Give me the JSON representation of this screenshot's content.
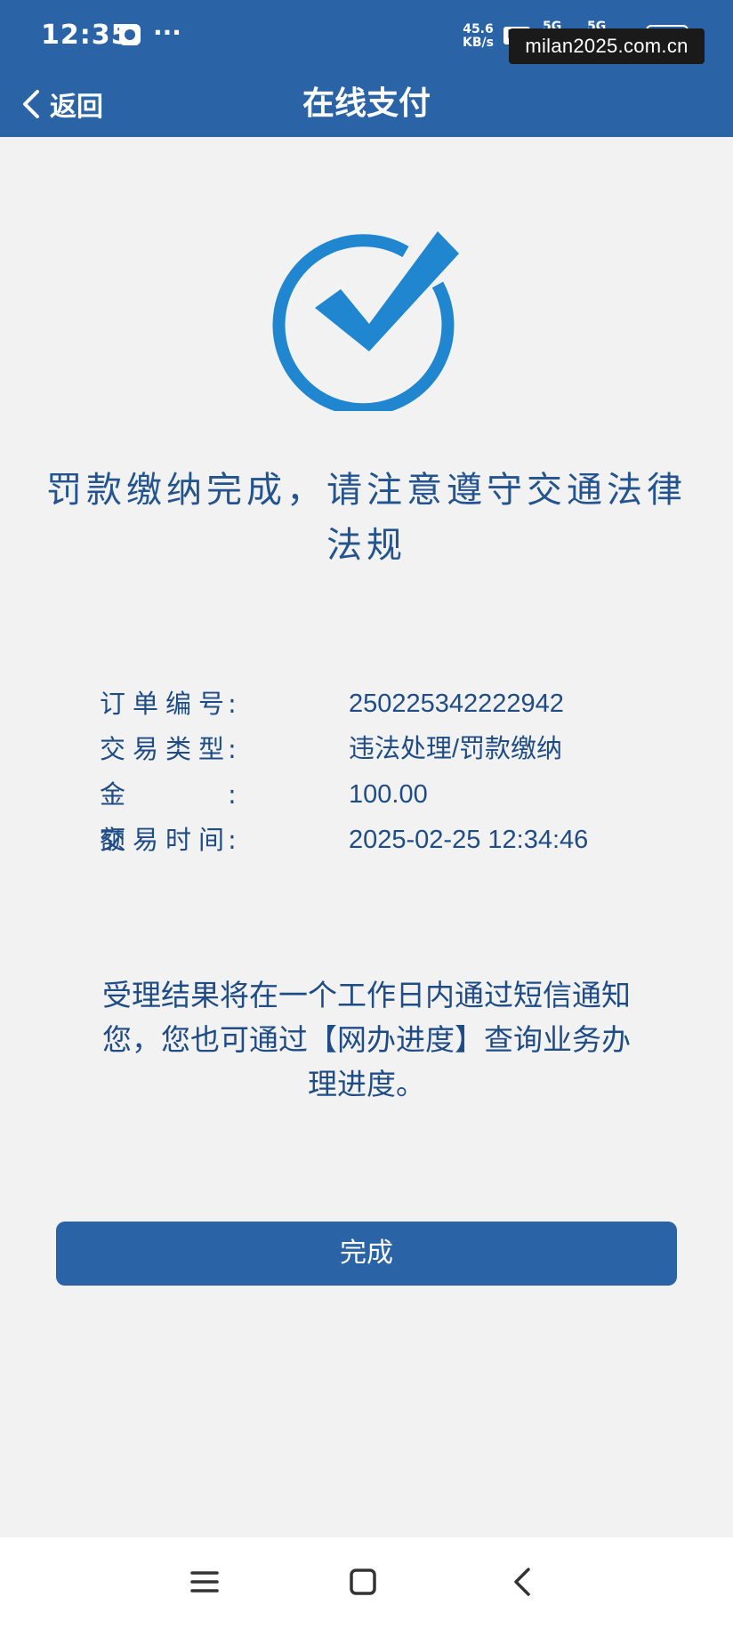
{
  "status_bar": {
    "time": "12:35",
    "more": "···",
    "speed_value": "45.6",
    "speed_unit": "KB/s",
    "hd": "HD",
    "signal1": "5G",
    "signal2": "5G",
    "battery": "87"
  },
  "watermark": "milan2025.com.cn",
  "header": {
    "back_label": "返回",
    "title": "在线支付"
  },
  "result": {
    "message": "罚款缴纳完成，请注意遵守交通法律法规"
  },
  "details": {
    "order_no": {
      "key": "订单编号",
      "value": "250225342222942"
    },
    "type": {
      "key": "交易类型",
      "value": "违法处理/罚款缴纳"
    },
    "amount": {
      "key": "金额",
      "value": "100.00"
    },
    "time": {
      "key": "交易时间",
      "value": "2025-02-25 12:34:46"
    },
    "colon": ":"
  },
  "notice": "受理结果将在一个工作日内通过短信通知您，您也可通过【网办进度】查询业务办理进度。",
  "done_button_label": "完成",
  "icons": {
    "success": "check-circle-icon",
    "back": "chevron-left-icon",
    "nav": [
      "menu-icon",
      "home-square-icon",
      "back-arrow-icon"
    ]
  },
  "colors": {
    "brand_blue": "#2a63a6",
    "icon_blue": "#1f86cf",
    "text_blue": "#23548f",
    "background": "#f2f2f2"
  }
}
